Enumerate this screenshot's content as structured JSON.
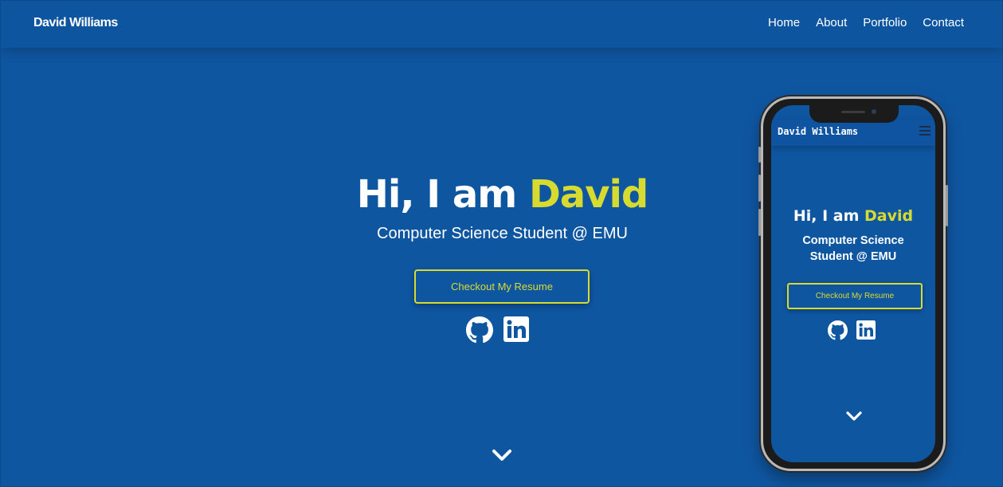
{
  "navbar": {
    "brand": "David Williams",
    "links": [
      "Home",
      "About",
      "Portfolio",
      "Contact"
    ]
  },
  "hero": {
    "title_prefix": "Hi, I am ",
    "title_name": "David",
    "subtitle": "Computer Science Student @ EMU",
    "resume_button": "Checkout My Resume",
    "social_icons": [
      "github-icon",
      "linkedin-icon"
    ],
    "scroll_icon": "chevron-down-icon"
  },
  "mobile_preview": {
    "brand": "David Williams",
    "menu_icon": "hamburger-menu-icon",
    "title_prefix": "Hi, I am ",
    "title_name": "David",
    "subtitle": "Computer Science Student @ EMU",
    "resume_button": "Checkout My Resume"
  },
  "colors": {
    "background": "#0f56a1",
    "accent": "#d8db2f",
    "text": "#ffffff"
  }
}
